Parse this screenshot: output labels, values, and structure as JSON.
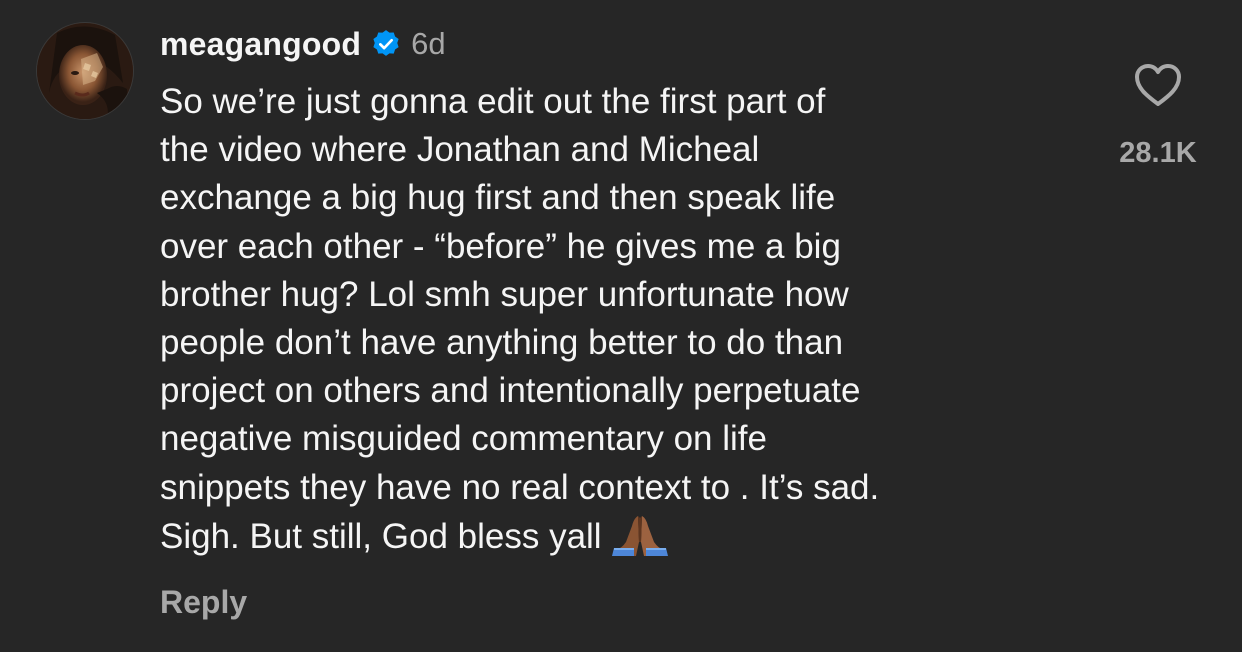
{
  "comment": {
    "username": "meagangood",
    "verified": true,
    "time": "6d",
    "text_lines": [
      "So we’re just gonna edit out the first part of",
      "the video where Jonathan and Micheal",
      "exchange a big hug first and then speak life",
      "over each other - “before” he gives me a big",
      "brother hug? Lol smh super unfortunate how",
      "people don’t have anything better to do than",
      "project on others and intentionally perpetuate",
      "negative misguided commentary on life",
      "snippets they have no real context to . It’s sad.",
      "Sigh. But still, God bless yall"
    ],
    "emoji": "folded-hands",
    "reply_label": "Reply",
    "like_count": "28.1K"
  },
  "icons": {
    "verified": "verified-badge-icon",
    "like": "heart-icon"
  },
  "colors": {
    "background": "#262626",
    "text": "#f5f5f5",
    "secondary": "#a8a8a8",
    "verified_blue": "#0095f6"
  }
}
